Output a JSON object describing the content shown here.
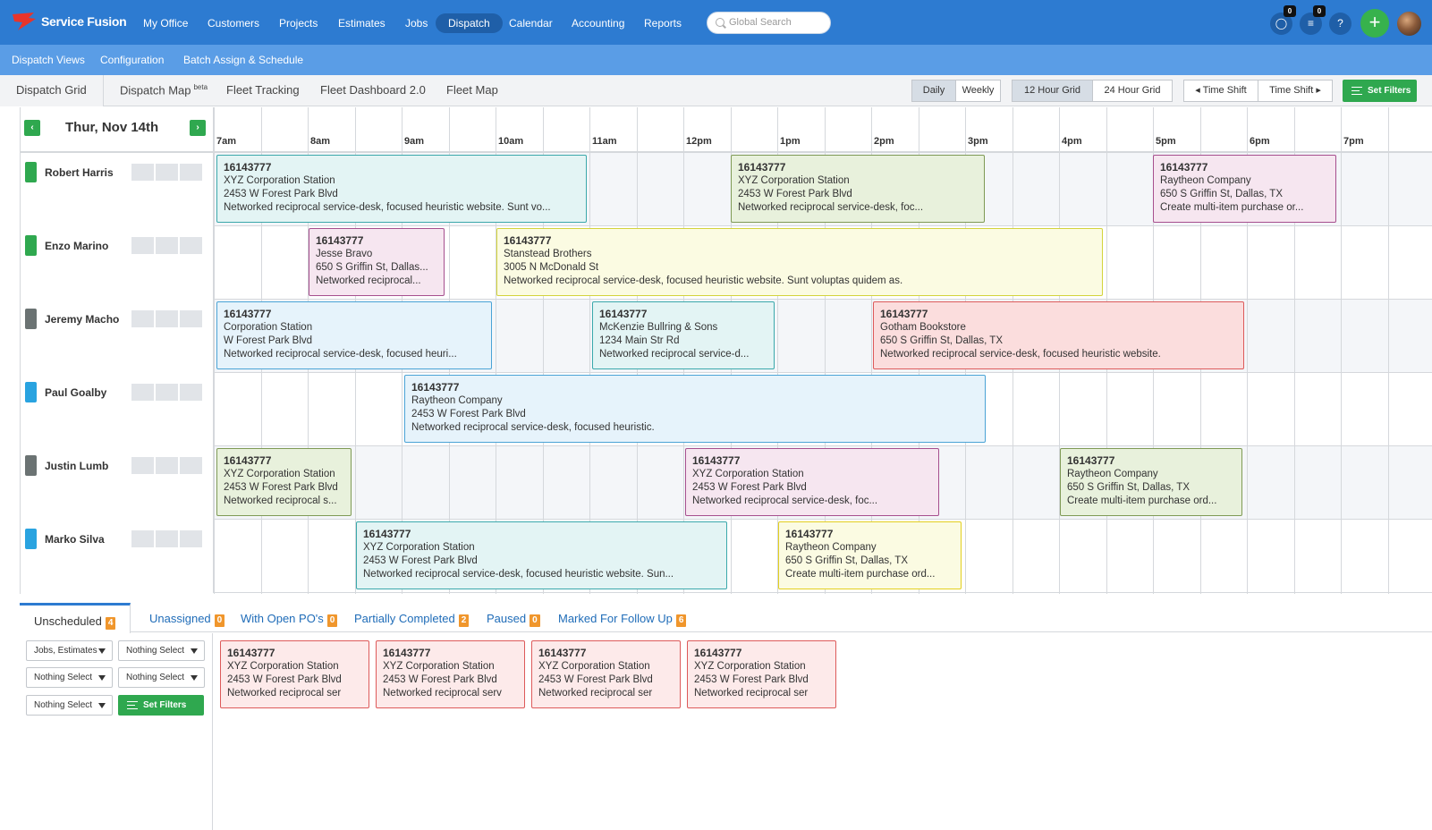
{
  "app": {
    "brand": "Service Fusion"
  },
  "topnav": {
    "items": [
      "My Office",
      "Customers",
      "Projects",
      "Estimates",
      "Jobs",
      "Dispatch",
      "Calendar",
      "Accounting",
      "Reports"
    ],
    "active": "Dispatch",
    "search_placeholder": "Global Search",
    "chat_badge": "0",
    "notes_badge": "0",
    "help_label": "?",
    "plus_label": "+"
  },
  "subnav": {
    "items": [
      "Dispatch Views",
      "Configuration",
      "Batch Assign & Schedule"
    ]
  },
  "viewtabs": {
    "dispatch_grid": "Dispatch Grid",
    "dispatch_map": "Dispatch Map",
    "beta": "beta",
    "fleet_tracking": "Fleet Tracking",
    "fleet_dashboard": "Fleet Dashboard 2.0",
    "fleet_map": "Fleet Map"
  },
  "controls": {
    "daily": "Daily",
    "weekly": "Weekly",
    "grid12": "12 Hour Grid",
    "grid24": "24 Hour Grid",
    "shift_back": "◂ Time Shift",
    "shift_fwd": "Time Shift ▸",
    "set_filters": "Set Filters"
  },
  "schedule": {
    "date": "Thur, Nov 14th",
    "prev": "‹",
    "next": "›",
    "hours": [
      "7am",
      "8am",
      "9am",
      "10am",
      "11am",
      "12pm",
      "1pm",
      "2pm",
      "3pm",
      "4pm",
      "5pm",
      "6pm",
      "7pm"
    ],
    "technicians": [
      {
        "name": "Robert Harris",
        "color": "#2fa84f"
      },
      {
        "name": "Enzo Marino",
        "color": "#2fa84f"
      },
      {
        "name": "Jeremy Macho",
        "color": "#6b7373"
      },
      {
        "name": "Paul Goalby",
        "color": "#29a3e0"
      },
      {
        "name": "Justin Lumb",
        "color": "#6b7373"
      },
      {
        "name": "Marko Silva",
        "color": "#29a3e0"
      }
    ],
    "jobs": [
      {
        "id": "16143777",
        "l1": "XYZ Corporation Station",
        "l2": "2453 W Forest Park Blvd",
        "l3": "Networked reciprocal service-desk, focused heuristic website. Sunt vo..."
      },
      {
        "id": "16143777",
        "l1": "XYZ Corporation Station",
        "l2": "2453 W Forest Park Blvd",
        "l3": "Networked reciprocal service-desk, foc..."
      },
      {
        "id": "16143777",
        "l1": "Raytheon Company",
        "l2": "650 S Griffin St, Dallas, TX",
        "l3": "Create multi-item purchase or..."
      },
      {
        "id": "16143777",
        "l1": "Jesse Bravo",
        "l2": "650 S Griffin St, Dallas...",
        "l3": "Networked reciprocal..."
      },
      {
        "id": "16143777",
        "l1": "Stanstead Brothers",
        "l2": "3005 N McDonald St",
        "l3": "Networked reciprocal service-desk, focused heuristic website. Sunt voluptas quidem as."
      },
      {
        "id": "16143777",
        "l1": "Corporation Station",
        "l2": "W Forest Park Blvd",
        "l3": "Networked reciprocal service-desk, focused heuri..."
      },
      {
        "id": "16143777",
        "l1": "McKenzie Bullring & Sons",
        "l2": "1234 Main Str Rd",
        "l3": "Networked reciprocal service-d..."
      },
      {
        "id": "16143777",
        "l1": "Gotham Bookstore",
        "l2": "650 S Griffin St, Dallas, TX",
        "l3": "Networked reciprocal service-desk, focused heuristic website."
      },
      {
        "id": "16143777",
        "l1": "Raytheon Company",
        "l2": "2453 W Forest Park Blvd",
        "l3": "Networked reciprocal service-desk, focused heuristic."
      },
      {
        "id": "16143777",
        "l1": "XYZ Corporation Station",
        "l2": "2453 W Forest Park Blvd",
        "l3": "Networked reciprocal s..."
      },
      {
        "id": "16143777",
        "l1": "XYZ Corporation Station",
        "l2": "2453 W Forest Park Blvd",
        "l3": "Networked reciprocal service-desk, foc..."
      },
      {
        "id": "16143777",
        "l1": "Raytheon Company",
        "l2": "650 S Griffin St, Dallas, TX",
        "l3": "Create multi-item purchase ord..."
      },
      {
        "id": "16143777",
        "l1": "XYZ Corporation Station",
        "l2": "2453 W Forest Park Blvd",
        "l3": "Networked reciprocal service-desk, focused heuristic website. Sun..."
      },
      {
        "id": "16143777",
        "l1": "Raytheon Company",
        "l2": "650 S Griffin St, Dallas, TX",
        "l3": "Create multi-item purchase ord..."
      }
    ]
  },
  "bottom": {
    "tabs": [
      {
        "label": "Unscheduled",
        "count": "4"
      },
      {
        "label": "Unassigned",
        "count": "0"
      },
      {
        "label": "With Open PO's",
        "count": "0"
      },
      {
        "label": "Partially Completed",
        "count": "2"
      },
      {
        "label": "Paused",
        "count": "0"
      },
      {
        "label": "Marked For Follow Up",
        "count": "6"
      }
    ],
    "filters": [
      "Jobs, Estimates",
      "Nothing Select",
      "Nothing Select",
      "Nothing Select",
      "Nothing Select"
    ],
    "set_filters": "Set Filters",
    "cards": [
      {
        "id": "16143777",
        "l1": "XYZ Corporation Station",
        "l2": "2453 W Forest Park Blvd",
        "l3": "Networked reciprocal ser"
      },
      {
        "id": "16143777",
        "l1": "XYZ Corporation Station",
        "l2": "2453 W Forest Park Blvd",
        "l3": "Networked reciprocal serv"
      },
      {
        "id": "16143777",
        "l1": "XYZ Corporation Station",
        "l2": "2453 W Forest Park Blvd",
        "l3": "Networked reciprocal ser"
      },
      {
        "id": "16143777",
        "l1": "XYZ Corporation Station",
        "l2": "2453 W Forest Park Blvd",
        "l3": "Networked reciprocal ser"
      }
    ]
  }
}
